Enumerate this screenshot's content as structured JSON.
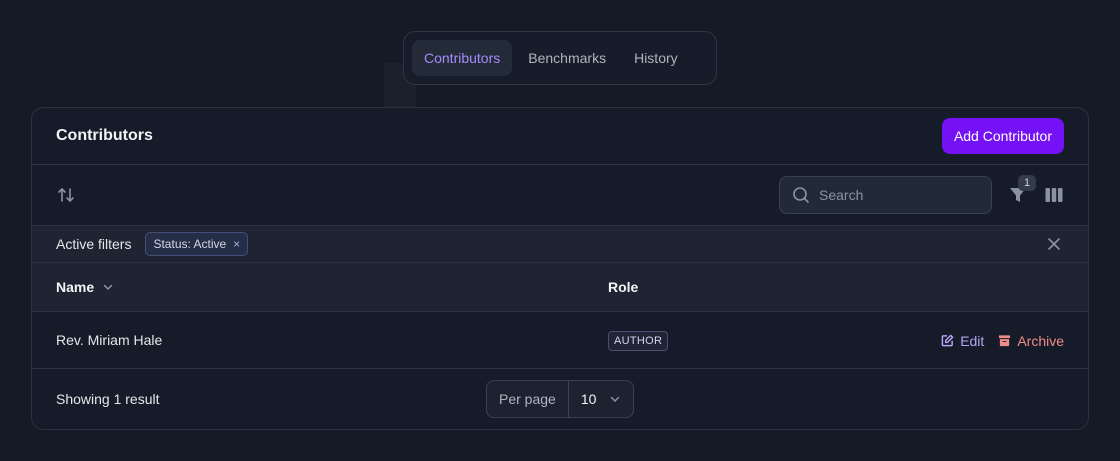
{
  "tabs": [
    {
      "label": "Contributors",
      "active": true
    },
    {
      "label": "Benchmarks",
      "active": false
    },
    {
      "label": "History",
      "active": false
    }
  ],
  "card": {
    "title": "Contributors",
    "add_button_label": "Add Contributor"
  },
  "toolbar": {
    "search_placeholder": "Search",
    "search_value": "",
    "filter_count": "1"
  },
  "filters": {
    "label": "Active filters",
    "chips": [
      {
        "text": "Status: Active",
        "remove_glyph": "×"
      }
    ]
  },
  "table": {
    "columns": [
      {
        "label": "Name",
        "sortable": true
      },
      {
        "label": "Role",
        "sortable": false
      }
    ],
    "rows": [
      {
        "name": "Rev. Miriam Hale",
        "role": "AUTHOR",
        "actions": {
          "edit": "Edit",
          "archive": "Archive"
        }
      }
    ]
  },
  "footer": {
    "result_text": "Showing 1 result",
    "per_page_label": "Per page",
    "per_page_value": "10"
  },
  "colors": {
    "background": "#141a26",
    "accent": "#7411f5",
    "active_tab": "#a78bfa",
    "edit": "#b4a3f5",
    "archive": "#f08c8c"
  },
  "icons": {
    "sort": "arrows-up-down-icon",
    "search": "search-icon",
    "filter": "funnel-icon",
    "columns": "columns-icon",
    "clear": "close-icon",
    "sort_column": "chevron-down-icon",
    "edit": "edit-icon",
    "archive": "archive-icon",
    "per_page": "chevron-down-icon"
  }
}
